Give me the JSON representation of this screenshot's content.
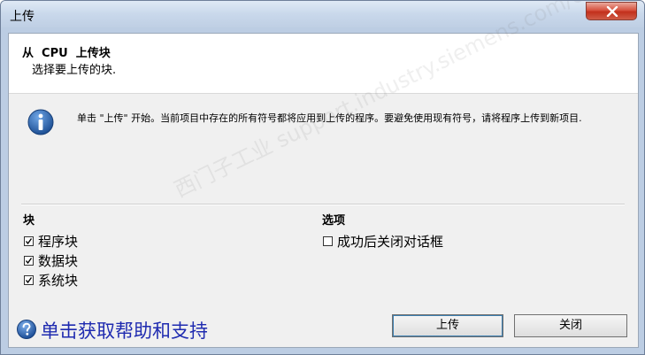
{
  "window": {
    "title": "上传"
  },
  "header": {
    "title": "从  CPU  上传块",
    "subtitle": "选择要上传的块."
  },
  "info": {
    "icon": "info-icon",
    "text": "单击 \"上传\" 开始。当前项目中存在的所有符号都将应用到上传的程序。要避免使用现有符号，请将程序上传到新项目."
  },
  "blocks": {
    "label": "块",
    "items": [
      {
        "label": "程序块",
        "checked": true
      },
      {
        "label": "数据块",
        "checked": true
      },
      {
        "label": "系统块",
        "checked": true
      }
    ]
  },
  "options": {
    "label": "选项",
    "items": [
      {
        "label": "成功后关闭对话框",
        "checked": false
      }
    ]
  },
  "help": {
    "icon": "help-icon",
    "label": "单击获取帮助和支持"
  },
  "buttons": {
    "upload": "上传",
    "close": "关闭"
  },
  "watermark": {
    "text": "西门子工业  support.industry.siemens.com/cs  找答案"
  },
  "colors": {
    "link": "#1f2bb0",
    "close_button": "#c2301c",
    "info_icon": "#1f5fa8"
  }
}
